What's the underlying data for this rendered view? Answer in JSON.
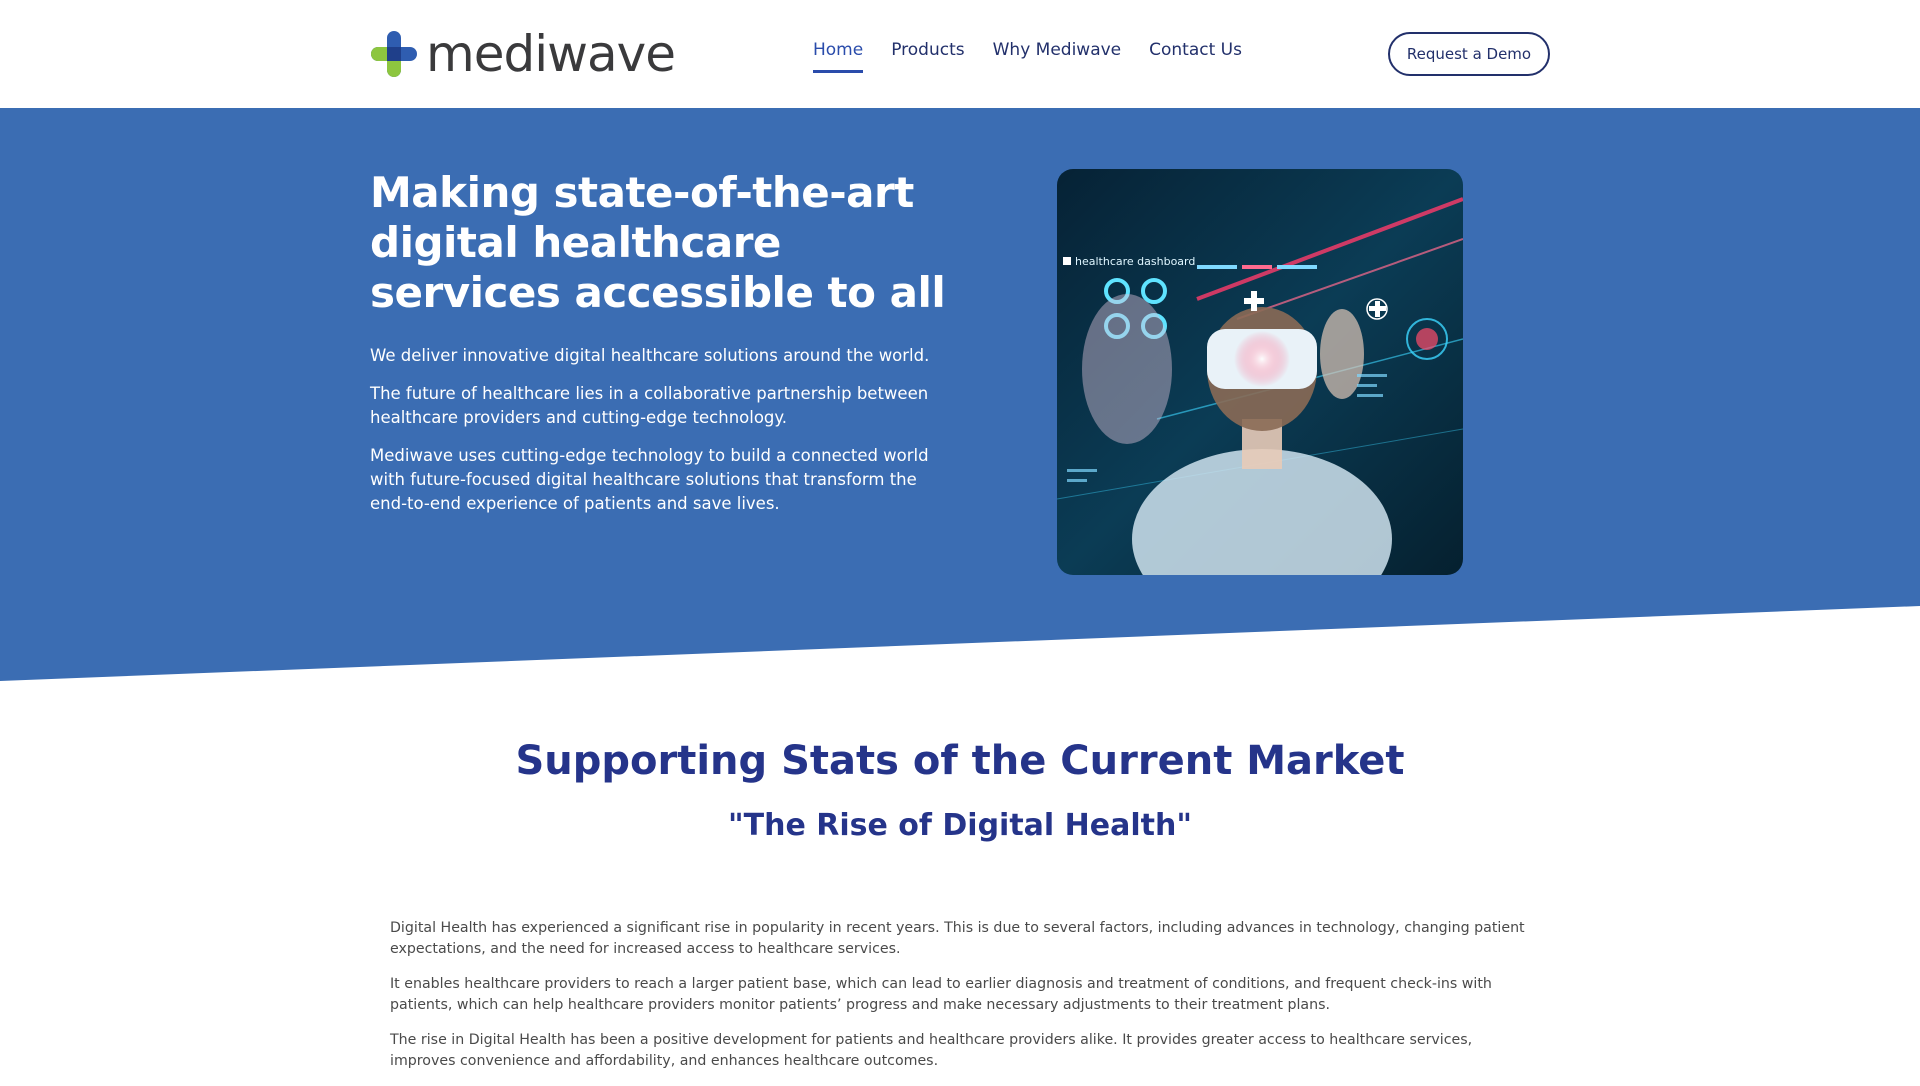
{
  "brand": {
    "name": "mediwave"
  },
  "nav": {
    "items": [
      {
        "label": "Home",
        "active": true
      },
      {
        "label": "Products",
        "active": false
      },
      {
        "label": "Why Mediwave",
        "active": false
      },
      {
        "label": "Contact Us",
        "active": false
      }
    ],
    "cta_label": "Request a Demo"
  },
  "hero": {
    "title": "Making state-of-the-art digital healthcare services accessible to all",
    "paragraphs": [
      "We deliver innovative digital healthcare solutions around the world.",
      "The future of healthcare lies in a collaborative partnership between healthcare providers and cutting-edge technology.",
      "Mediwave uses cutting-edge technology to build a connected world with future-focused digital healthcare solutions that transform the end-to-end experience of patients and save lives."
    ],
    "image_caption": "healthcare dashboard"
  },
  "stats": {
    "title": "Supporting Stats of the Current Market",
    "subtitle": "\"The Rise of Digital Health\"",
    "paragraphs": [
      "Digital Health has experienced a significant rise in popularity in recent years. This is due to several factors, including advances in technology, changing patient expectations, and the need for increased access to healthcare services.",
      "It enables healthcare providers to reach a larger patient base, which can lead to earlier diagnosis and treatment of conditions, and frequent check-ins with patients, which can help healthcare providers monitor patients’ progress and make necessary adjustments to their treatment plans.",
      "The rise in Digital Health has been a positive development for patients and healthcare providers alike. It provides greater access to healthcare services, improves convenience and affordability, and enhances healthcare outcomes."
    ]
  },
  "colors": {
    "hero_blue": "#3b6db3",
    "heading_navy": "#25348a",
    "nav_text": "#22306b",
    "logo_blue": "#2f5db0",
    "logo_green": "#8dc63f"
  },
  "icons": {
    "logo": "medical-cross-logo-icon"
  }
}
